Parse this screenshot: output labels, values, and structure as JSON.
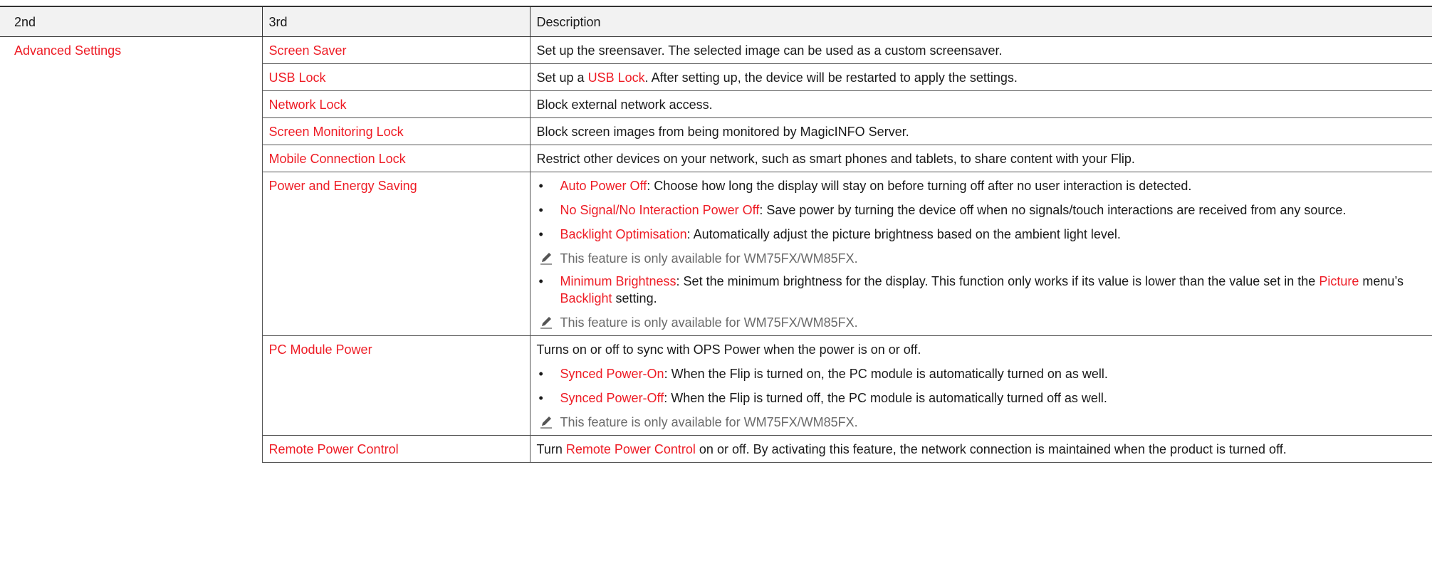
{
  "header": {
    "col2": "2nd",
    "col3": "3rd",
    "col4": "Description"
  },
  "section": "Advanced Settings",
  "rows": {
    "screen_saver": {
      "name": "Screen Saver",
      "desc": "Set up the sreensaver. The selected image can be used as a custom screensaver."
    },
    "usb_lock": {
      "name": "USB Lock",
      "desc_pre": "Set up a ",
      "desc_link": "USB Lock",
      "desc_post": ". After setting up, the device will be restarted to apply the settings."
    },
    "network_lock": {
      "name": "Network Lock",
      "desc": "Block external network access."
    },
    "screen_monitoring_lock": {
      "name": "Screen Monitoring Lock",
      "desc": "Block screen images from being monitored by MagicINFO Server."
    },
    "mobile_connection_lock": {
      "name": "Mobile Connection Lock",
      "desc": "Restrict other devices on your network, such as smart phones and tablets, to share content with your Flip."
    },
    "power_energy": {
      "name": "Power and Energy Saving",
      "items": {
        "auto_power_off": {
          "term": "Auto Power Off",
          "text": ": Choose how long the display will stay on before turning off after no user interaction is detected."
        },
        "no_signal": {
          "term": "No Signal/No Interaction Power Off",
          "text": ": Save power by turning the device off when no signals/touch interactions are received from any source."
        },
        "backlight_opt": {
          "term": "Backlight Optimisation",
          "text": ": Automatically adjust the picture brightness based on the ambient light level."
        },
        "backlight_note": "This feature is only available for WM75FX/WM85FX.",
        "min_brightness": {
          "term": "Minimum Brightness",
          "text_a": ": Set the minimum brightness for the display. This function only works if its value is lower than the value set in the ",
          "term_b": "Picture",
          "text_b": " menu’s ",
          "term_c": "Backlight",
          "text_c": " setting."
        },
        "min_note": "This feature is only available for WM75FX/WM85FX."
      }
    },
    "pc_module": {
      "name": "PC Module Power",
      "intro": "Turns on or off to sync with OPS Power when the power is on or off.",
      "synced_on": {
        "term": "Synced Power-On",
        "text": ": When the Flip is turned on, the PC module is automatically turned on as well."
      },
      "synced_off": {
        "term": "Synced Power-Off",
        "text": ": When the Flip is turned off, the PC module is automatically turned off as well."
      },
      "note": "This feature is only available for WM75FX/WM85FX."
    },
    "remote_power": {
      "name": "Remote Power Control",
      "desc_pre": "Turn ",
      "desc_link": "Remote Power Control",
      "desc_post": " on or off. By activating this feature, the network connection is maintained when the product is turned off."
    }
  },
  "colors": {
    "accent": "#ee1c25",
    "header_bg": "#f2f2f2",
    "note": "#6a6a6a"
  },
  "icons": {
    "note": "pencil-icon"
  }
}
